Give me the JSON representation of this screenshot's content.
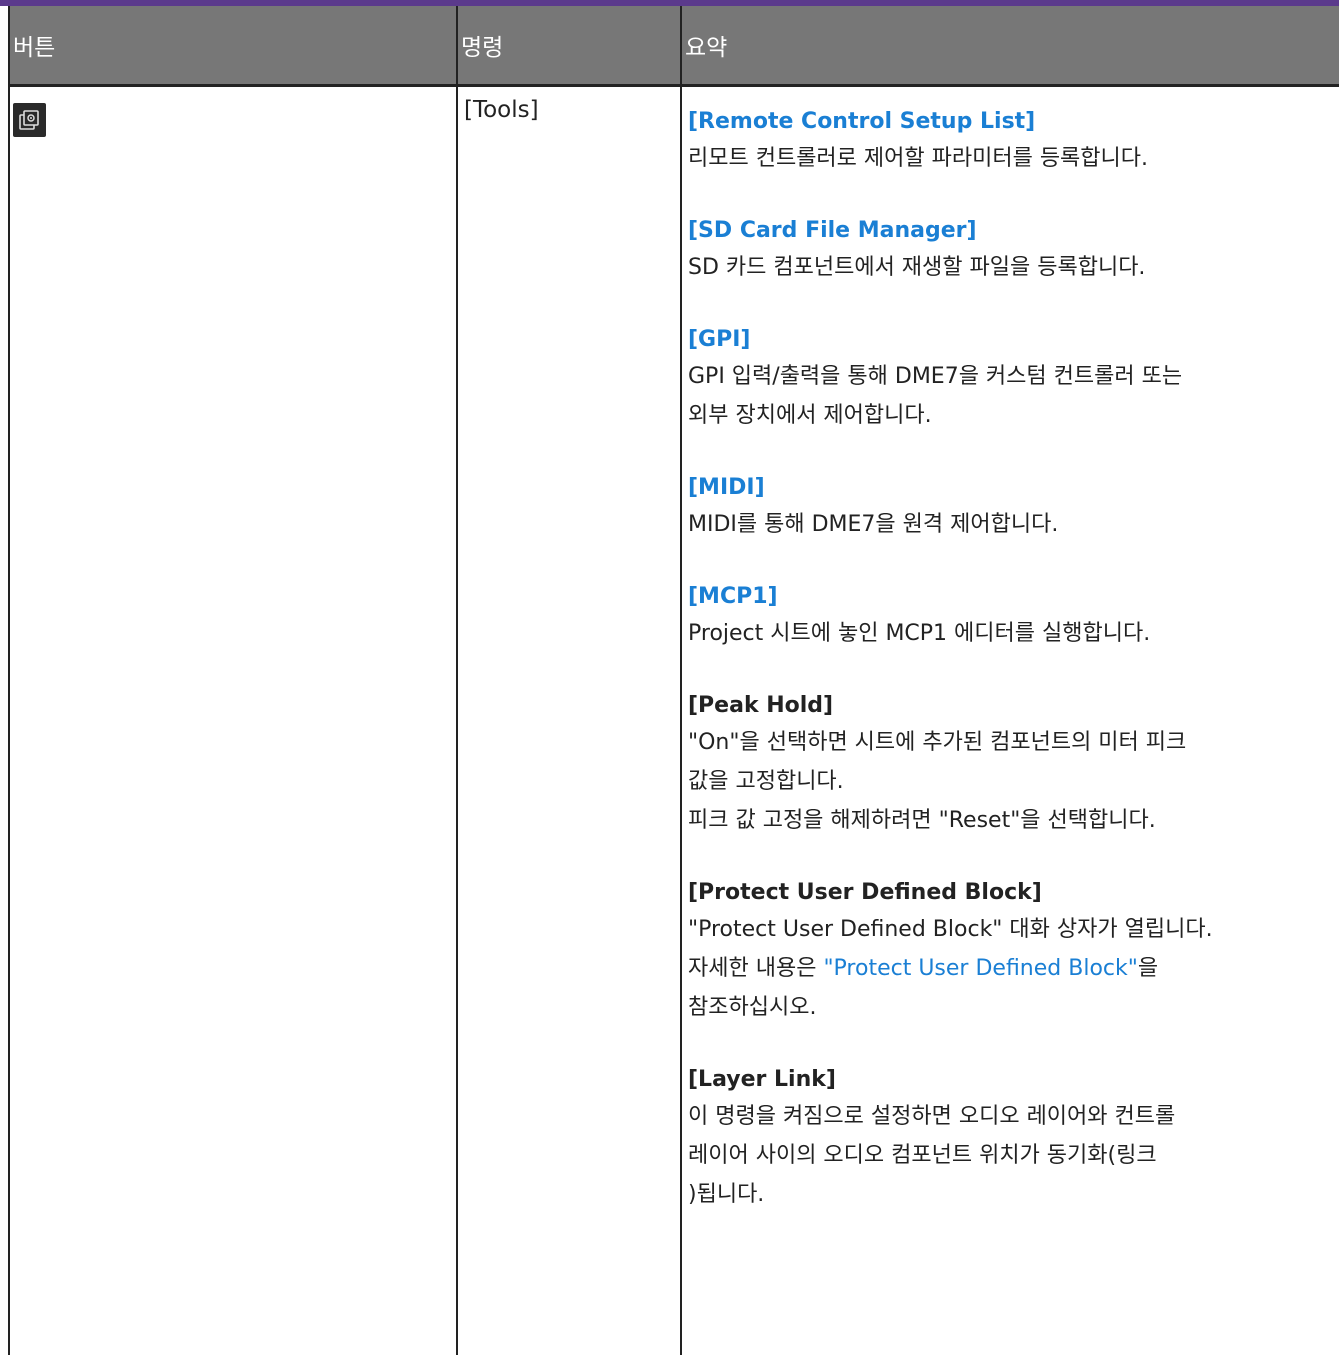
{
  "table": {
    "headers": [
      "버튼",
      "명령",
      "요약"
    ],
    "command": "[Tools]",
    "button_icon": "tools-icon",
    "entries": [
      {
        "title": "[Remote Control Setup List]",
        "is_link": true,
        "lines": [
          "리모트 컨트롤러로 제어할 파라미터를 등록합니다."
        ]
      },
      {
        "title": "[SD Card File Manager]",
        "is_link": true,
        "lines": [
          "SD 카드 컴포넌트에서 재생할 파일을 등록합니다."
        ]
      },
      {
        "title": "[GPI]",
        "is_link": true,
        "lines": [
          "GPI 입력/출력을 통해 DME7을 커스텀 컨트롤러 또는",
          "외부 장치에서 제어합니다."
        ]
      },
      {
        "title": "[MIDI]",
        "is_link": true,
        "lines": [
          "MIDI를 통해 DME7을 원격 제어합니다."
        ]
      },
      {
        "title": "[MCP1]",
        "is_link": true,
        "lines": [
          "Project 시트에 놓인 MCP1 에디터를 실행합니다."
        ]
      },
      {
        "title": "[Peak Hold]",
        "is_link": false,
        "lines": [
          "\"On\"을 선택하면 시트에 추가된 컴포넌트의 미터 피크",
          "값을 고정합니다.",
          "피크 값 고정을 해제하려면 \"Reset\"을 선택합니다."
        ]
      },
      {
        "title": "[Protect User Defined Block]",
        "is_link": false,
        "lines": [
          "\"Protect User Defined Block\" 대화 상자가 열립니다."
        ],
        "ref": {
          "prefix": "자세한 내용은 ",
          "link": "\"Protect User Defined Block\"",
          "suffix": "을",
          "after": "참조하십시오."
        }
      },
      {
        "title": "[Layer Link]",
        "is_link": false,
        "lines": [
          "이 명령을 켜짐으로 설정하면 오디오 레이어와 컨트롤",
          "레이어 사이의 오디오 컴포넌트 위치가 동기화(링크",
          ")됩니다."
        ]
      }
    ]
  },
  "colors": {
    "header_bg": "#777777",
    "link": "#1a7fd4",
    "top_rule": "#5b3a8c"
  }
}
